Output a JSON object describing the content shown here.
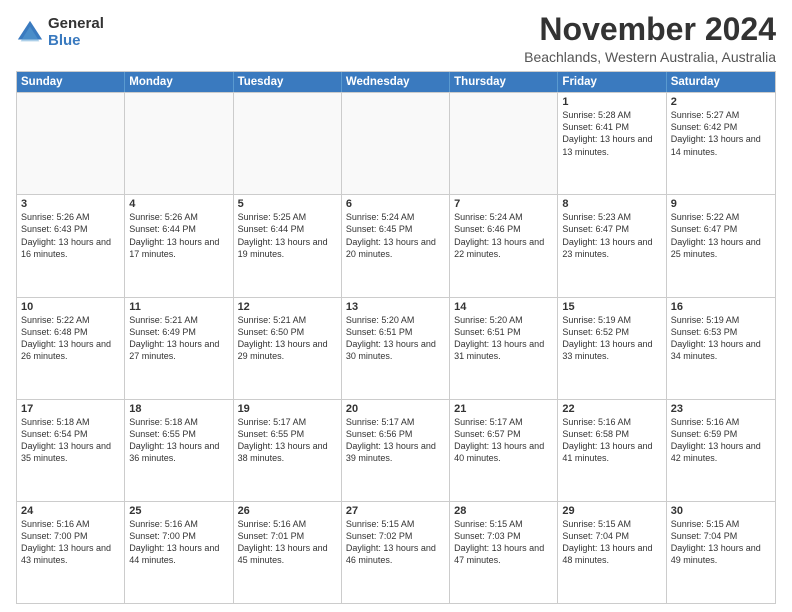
{
  "logo": {
    "general": "General",
    "blue": "Blue"
  },
  "title": "November 2024",
  "location": "Beachlands, Western Australia, Australia",
  "days": [
    "Sunday",
    "Monday",
    "Tuesday",
    "Wednesday",
    "Thursday",
    "Friday",
    "Saturday"
  ],
  "weeks": [
    [
      {
        "day": "",
        "info": ""
      },
      {
        "day": "",
        "info": ""
      },
      {
        "day": "",
        "info": ""
      },
      {
        "day": "",
        "info": ""
      },
      {
        "day": "",
        "info": ""
      },
      {
        "day": "1",
        "info": "Sunrise: 5:28 AM\nSunset: 6:41 PM\nDaylight: 13 hours\nand 13 minutes."
      },
      {
        "day": "2",
        "info": "Sunrise: 5:27 AM\nSunset: 6:42 PM\nDaylight: 13 hours\nand 14 minutes."
      }
    ],
    [
      {
        "day": "3",
        "info": "Sunrise: 5:26 AM\nSunset: 6:43 PM\nDaylight: 13 hours\nand 16 minutes."
      },
      {
        "day": "4",
        "info": "Sunrise: 5:26 AM\nSunset: 6:44 PM\nDaylight: 13 hours\nand 17 minutes."
      },
      {
        "day": "5",
        "info": "Sunrise: 5:25 AM\nSunset: 6:44 PM\nDaylight: 13 hours\nand 19 minutes."
      },
      {
        "day": "6",
        "info": "Sunrise: 5:24 AM\nSunset: 6:45 PM\nDaylight: 13 hours\nand 20 minutes."
      },
      {
        "day": "7",
        "info": "Sunrise: 5:24 AM\nSunset: 6:46 PM\nDaylight: 13 hours\nand 22 minutes."
      },
      {
        "day": "8",
        "info": "Sunrise: 5:23 AM\nSunset: 6:47 PM\nDaylight: 13 hours\nand 23 minutes."
      },
      {
        "day": "9",
        "info": "Sunrise: 5:22 AM\nSunset: 6:47 PM\nDaylight: 13 hours\nand 25 minutes."
      }
    ],
    [
      {
        "day": "10",
        "info": "Sunrise: 5:22 AM\nSunset: 6:48 PM\nDaylight: 13 hours\nand 26 minutes."
      },
      {
        "day": "11",
        "info": "Sunrise: 5:21 AM\nSunset: 6:49 PM\nDaylight: 13 hours\nand 27 minutes."
      },
      {
        "day": "12",
        "info": "Sunrise: 5:21 AM\nSunset: 6:50 PM\nDaylight: 13 hours\nand 29 minutes."
      },
      {
        "day": "13",
        "info": "Sunrise: 5:20 AM\nSunset: 6:51 PM\nDaylight: 13 hours\nand 30 minutes."
      },
      {
        "day": "14",
        "info": "Sunrise: 5:20 AM\nSunset: 6:51 PM\nDaylight: 13 hours\nand 31 minutes."
      },
      {
        "day": "15",
        "info": "Sunrise: 5:19 AM\nSunset: 6:52 PM\nDaylight: 13 hours\nand 33 minutes."
      },
      {
        "day": "16",
        "info": "Sunrise: 5:19 AM\nSunset: 6:53 PM\nDaylight: 13 hours\nand 34 minutes."
      }
    ],
    [
      {
        "day": "17",
        "info": "Sunrise: 5:18 AM\nSunset: 6:54 PM\nDaylight: 13 hours\nand 35 minutes."
      },
      {
        "day": "18",
        "info": "Sunrise: 5:18 AM\nSunset: 6:55 PM\nDaylight: 13 hours\nand 36 minutes."
      },
      {
        "day": "19",
        "info": "Sunrise: 5:17 AM\nSunset: 6:55 PM\nDaylight: 13 hours\nand 38 minutes."
      },
      {
        "day": "20",
        "info": "Sunrise: 5:17 AM\nSunset: 6:56 PM\nDaylight: 13 hours\nand 39 minutes."
      },
      {
        "day": "21",
        "info": "Sunrise: 5:17 AM\nSunset: 6:57 PM\nDaylight: 13 hours\nand 40 minutes."
      },
      {
        "day": "22",
        "info": "Sunrise: 5:16 AM\nSunset: 6:58 PM\nDaylight: 13 hours\nand 41 minutes."
      },
      {
        "day": "23",
        "info": "Sunrise: 5:16 AM\nSunset: 6:59 PM\nDaylight: 13 hours\nand 42 minutes."
      }
    ],
    [
      {
        "day": "24",
        "info": "Sunrise: 5:16 AM\nSunset: 7:00 PM\nDaylight: 13 hours\nand 43 minutes."
      },
      {
        "day": "25",
        "info": "Sunrise: 5:16 AM\nSunset: 7:00 PM\nDaylight: 13 hours\nand 44 minutes."
      },
      {
        "day": "26",
        "info": "Sunrise: 5:16 AM\nSunset: 7:01 PM\nDaylight: 13 hours\nand 45 minutes."
      },
      {
        "day": "27",
        "info": "Sunrise: 5:15 AM\nSunset: 7:02 PM\nDaylight: 13 hours\nand 46 minutes."
      },
      {
        "day": "28",
        "info": "Sunrise: 5:15 AM\nSunset: 7:03 PM\nDaylight: 13 hours\nand 47 minutes."
      },
      {
        "day": "29",
        "info": "Sunrise: 5:15 AM\nSunset: 7:04 PM\nDaylight: 13 hours\nand 48 minutes."
      },
      {
        "day": "30",
        "info": "Sunrise: 5:15 AM\nSunset: 7:04 PM\nDaylight: 13 hours\nand 49 minutes."
      }
    ]
  ]
}
